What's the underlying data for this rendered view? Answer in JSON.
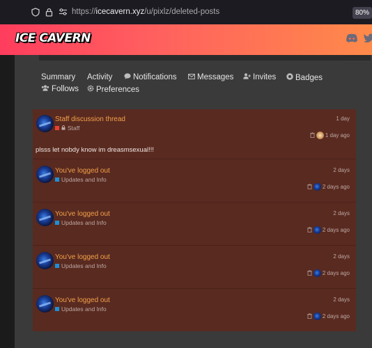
{
  "browser": {
    "url_prefix": "https://",
    "url_domain": "icecavern.xyz",
    "url_path": "/u/pixlz/deleted-posts",
    "zoom": "80%"
  },
  "site": {
    "logo": "ICE CAVERN"
  },
  "nav": {
    "items": [
      {
        "label": "Summary",
        "icon": ""
      },
      {
        "label": "Activity",
        "icon": ""
      },
      {
        "label": "Notifications",
        "icon": "comment-icon"
      },
      {
        "label": "Messages",
        "icon": "envelope-icon"
      },
      {
        "label": "Invites",
        "icon": "user-plus-icon"
      },
      {
        "label": "Badges",
        "icon": "certificate-icon"
      },
      {
        "label": "Follows",
        "icon": "users-icon"
      },
      {
        "label": "Preferences",
        "icon": "gear-icon"
      }
    ]
  },
  "posts": [
    {
      "title": "Staff discussion thread",
      "category": "Staff",
      "category_color": "#e8412f",
      "locked": true,
      "age": "1 day",
      "meta_age": "1 day ago",
      "body": "plsss let nobdy know im dreasmsexual!!!"
    },
    {
      "title": "You've logged out",
      "category": "Updates and Info",
      "category_color": "#1e8fd6",
      "locked": false,
      "age": "2 days",
      "meta_age": "2 days ago",
      "body": ""
    },
    {
      "title": "You've logged out",
      "category": "Updates and Info",
      "category_color": "#1e8fd6",
      "locked": false,
      "age": "2 days",
      "meta_age": "2 days ago",
      "body": ""
    },
    {
      "title": "You've logged out",
      "category": "Updates and Info",
      "category_color": "#1e8fd6",
      "locked": false,
      "age": "2 days",
      "meta_age": "2 days ago",
      "body": ""
    },
    {
      "title": "You've logged out",
      "category": "Updates and Info",
      "category_color": "#1e8fd6",
      "locked": false,
      "age": "2 days",
      "meta_age": "2 days ago",
      "body": ""
    }
  ]
}
